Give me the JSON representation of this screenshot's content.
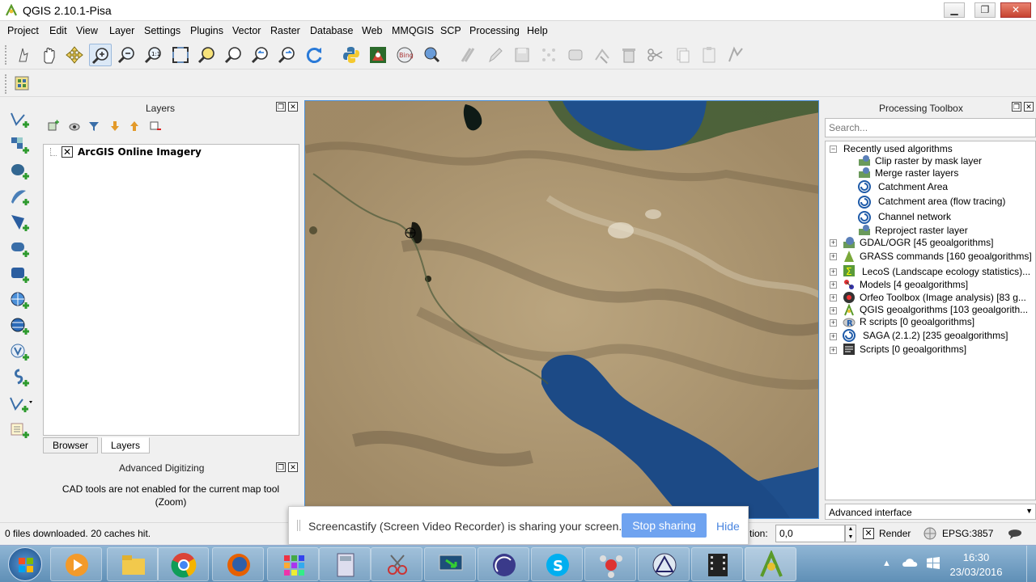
{
  "window": {
    "title": "QGIS 2.10.1-Pisa",
    "minimize_glyph": "▁",
    "maximize_glyph": "❐",
    "close_glyph": "✕"
  },
  "menu": [
    "Project",
    "Edit",
    "View",
    "Layer",
    "Settings",
    "Plugins",
    "Vector",
    "Raster",
    "Database",
    "Web",
    "MMQGIS",
    "SCP",
    "Processing",
    "Help"
  ],
  "layers_panel": {
    "title": "Layers",
    "layer_name": "ArcGIS Online Imagery",
    "tabs": [
      "Browser",
      "Layers"
    ],
    "active_tab": "Layers"
  },
  "advanced_digitizing": {
    "title": "Advanced Digitizing",
    "message": "CAD tools are not enabled for the current map tool (Zoom)"
  },
  "processing_toolbox": {
    "title": "Processing Toolbox",
    "search_placeholder": "Search...",
    "recent_group": "Recently used algorithms",
    "recent": [
      "Clip raster by mask layer",
      "Merge raster layers",
      "Catchment Area",
      "Catchment area (flow tracing)",
      "Channel network",
      "Reproject raster layer"
    ],
    "providers": [
      "GDAL/OGR [45 geoalgorithms]",
      "GRASS commands [160 geoalgorithms]",
      "LecoS (Landscape ecology statistics)...",
      "Models [4 geoalgorithms]",
      "Orfeo Toolbox (Image analysis) [83 g...",
      "QGIS geoalgorithms [103 geoalgorith...",
      "R scripts [0 geoalgorithms]",
      "SAGA (2.1.2) [235 geoalgorithms]",
      "Scripts [0 geoalgorithms]"
    ],
    "interface_mode": "Advanced interface"
  },
  "statusbar": {
    "message": "0 files downloaded. 20 caches hit.",
    "rotation_label": "tion:",
    "rotation_value": "0,0",
    "render_label": "Render",
    "crs": "EPSG:3857"
  },
  "screencast": {
    "message": "Screencastify (Screen Video Recorder) is sharing your screen.",
    "stop_label": "Stop sharing",
    "hide_label": "Hide"
  },
  "taskbar": {
    "time": "16:30",
    "date": "23/03/2016"
  },
  "colors": {
    "accent": "#6fa3f0",
    "map_border": "#4a8fd8",
    "sea": "#1f4f8c",
    "desert": "#a58d68"
  }
}
